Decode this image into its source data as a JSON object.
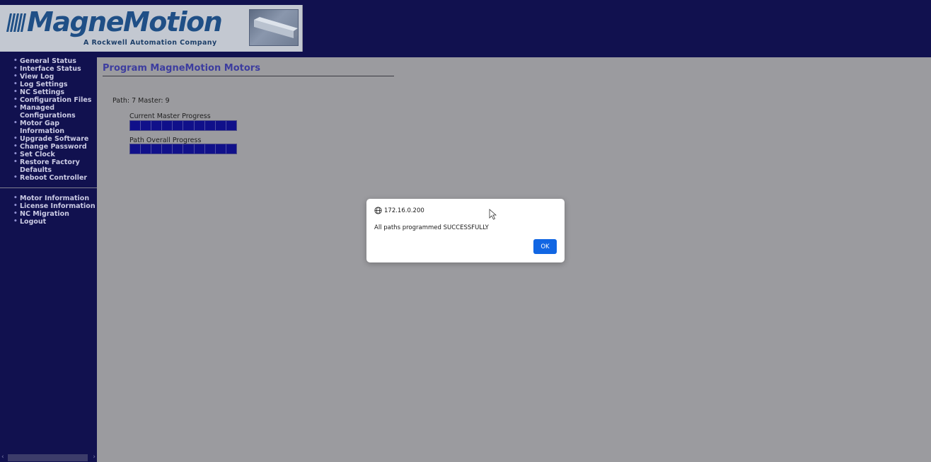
{
  "header": {
    "logo_text": "MagneMotion",
    "tagline": "A Rockwell Automation Company"
  },
  "sidebar": {
    "main_items": [
      {
        "label": "General Status"
      },
      {
        "label": "Interface Status"
      },
      {
        "label": "View Log"
      },
      {
        "label": "Log Settings"
      },
      {
        "label": "NC Settings"
      },
      {
        "label": "Configuration Files"
      },
      {
        "label": "Managed Configurations"
      },
      {
        "label": "Motor Gap Information"
      },
      {
        "label": "Upgrade Software"
      },
      {
        "label": "Change Password"
      },
      {
        "label": "Set Clock"
      },
      {
        "label": "Restore Factory Defaults"
      },
      {
        "label": "Reboot Controller"
      }
    ],
    "secondary_items": [
      {
        "label": "Motor Information"
      },
      {
        "label": "License Information"
      },
      {
        "label": "NC Migration"
      },
      {
        "label": "Logout"
      }
    ]
  },
  "main": {
    "page_title": "Program MagneMotion Motors",
    "path_info": "Path: 7  Master: 9",
    "current_master_progress_label": "Current Master Progress",
    "current_master_progress_fraction": 1.0,
    "path_overall_progress_label": "Path Overall Progress",
    "path_overall_progress_fraction": 1.0
  },
  "dialog": {
    "origin": "172.16.0.200",
    "message": "All paths programmed SUCCESSFULLY",
    "ok_label": "OK"
  },
  "colors": {
    "sidebar_bg": "#11114f",
    "page_title": "#3d3d9f",
    "progress_fill": "#10108a",
    "ok_button": "#1166e3"
  }
}
